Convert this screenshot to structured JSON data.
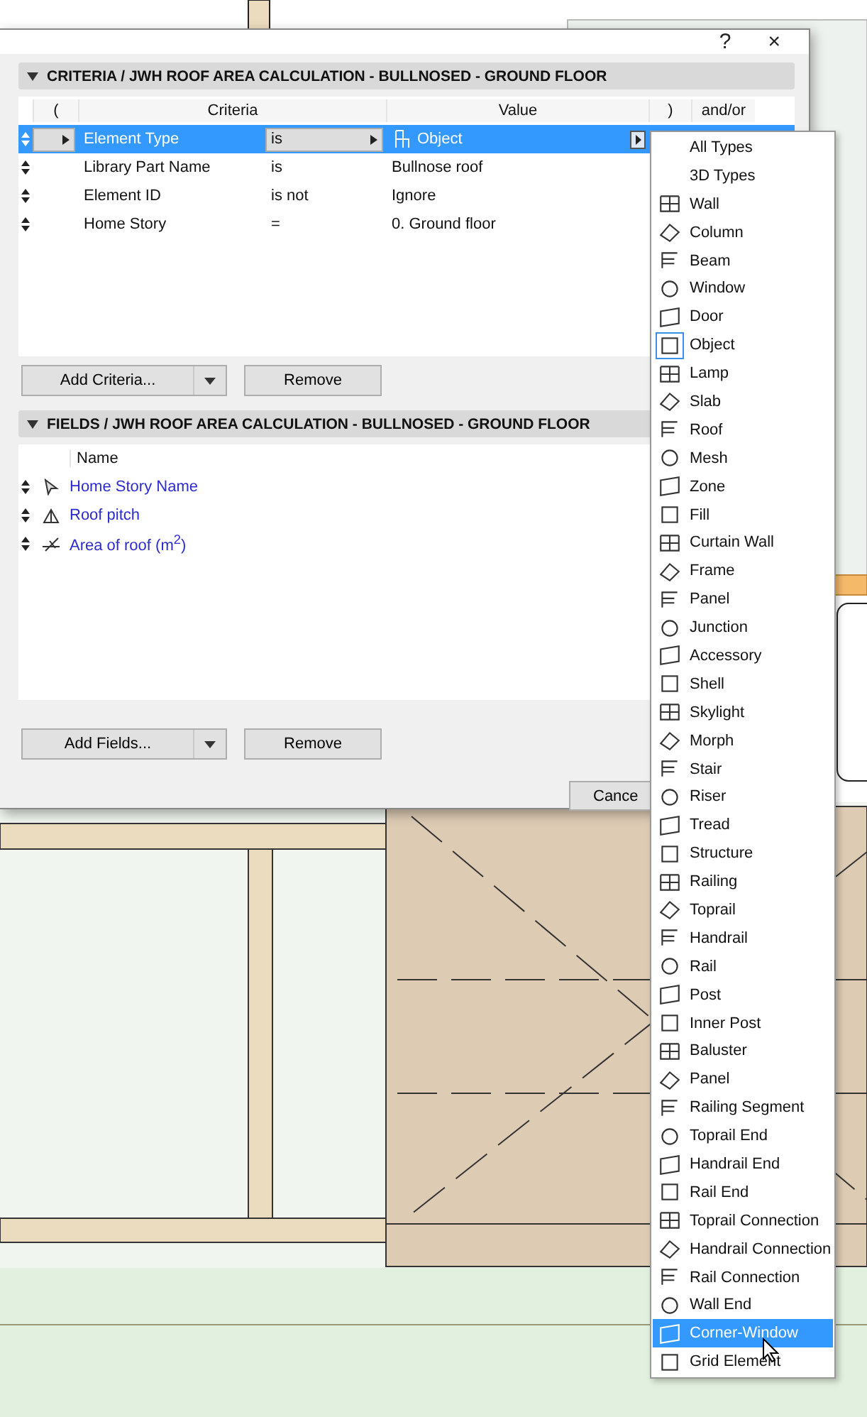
{
  "dialog": {
    "help": "?",
    "close": "×",
    "criteria": {
      "title": "CRITERIA / JWH ROOF AREA CALCULATION - BULLNOSED - GROUND FLOOR",
      "expanded": true,
      "columns": [
        "(",
        "Criteria",
        "Value",
        ")",
        "and/or"
      ],
      "rows": [
        {
          "criteria": "Element Type",
          "operator": "is",
          "value": "Object",
          "selected": true
        },
        {
          "criteria": "Library Part Name",
          "operator": "is",
          "value": "Bullnose roof",
          "selected": false
        },
        {
          "criteria": "Element ID",
          "operator": "is not",
          "value": "Ignore",
          "selected": false
        },
        {
          "criteria": "Home Story",
          "operator": "=",
          "value": "0. Ground floor",
          "selected": false
        }
      ],
      "buttons": [
        "Add Criteria...",
        "Remove"
      ]
    },
    "fields": {
      "title": "FIELDS / JWH ROOF AREA CALCULATION - BULLNOSED - GROUND FLOOR",
      "expanded": true,
      "column": "Name",
      "rows": [
        {
          "name": "Home Story Name",
          "kind": "pointer"
        },
        {
          "name": "Roof pitch",
          "kind": "angle"
        },
        {
          "name": "Area of roof (m$^{2}$)",
          "kind": "area"
        }
      ],
      "buttons": [
        "Add Fields...",
        "Remove"
      ]
    },
    "cancel": "Cance"
  },
  "menu": [
    {
      "label": "All Types",
      "selected": false,
      "current": false
    },
    {
      "label": "3D Types",
      "selected": false,
      "current": false
    },
    {
      "label": "Wall",
      "selected": false,
      "current": false
    },
    {
      "label": "Column",
      "selected": false,
      "current": false
    },
    {
      "label": "Beam",
      "selected": false,
      "current": false
    },
    {
      "label": "Window",
      "selected": false,
      "current": false
    },
    {
      "label": "Door",
      "selected": false,
      "current": false
    },
    {
      "label": "Object",
      "selected": false,
      "current": true
    },
    {
      "label": "Lamp",
      "selected": false,
      "current": false
    },
    {
      "label": "Slab",
      "selected": false,
      "current": false
    },
    {
      "label": "Roof",
      "selected": false,
      "current": false
    },
    {
      "label": "Mesh",
      "selected": false,
      "current": false
    },
    {
      "label": "Zone",
      "selected": false,
      "current": false
    },
    {
      "label": "Fill",
      "selected": false,
      "current": false
    },
    {
      "label": "Curtain Wall",
      "selected": false,
      "current": false
    },
    {
      "label": "Frame",
      "selected": false,
      "current": false
    },
    {
      "label": "Panel",
      "selected": false,
      "current": false
    },
    {
      "label": "Junction",
      "selected": false,
      "current": false
    },
    {
      "label": "Accessory",
      "selected": false,
      "current": false
    },
    {
      "label": "Shell",
      "selected": false,
      "current": false
    },
    {
      "label": "Skylight",
      "selected": false,
      "current": false
    },
    {
      "label": "Morph",
      "selected": false,
      "current": false
    },
    {
      "label": "Stair",
      "selected": false,
      "current": false
    },
    {
      "label": "Riser",
      "selected": false,
      "current": false
    },
    {
      "label": "Tread",
      "selected": false,
      "current": false
    },
    {
      "label": "Structure",
      "selected": false,
      "current": false
    },
    {
      "label": "Railing",
      "selected": false,
      "current": false
    },
    {
      "label": "Toprail",
      "selected": false,
      "current": false
    },
    {
      "label": "Handrail",
      "selected": false,
      "current": false
    },
    {
      "label": "Rail",
      "selected": false,
      "current": false
    },
    {
      "label": "Post",
      "selected": false,
      "current": false
    },
    {
      "label": "Inner Post",
      "selected": false,
      "current": false
    },
    {
      "label": "Baluster",
      "selected": false,
      "current": false
    },
    {
      "label": "Panel",
      "selected": false,
      "current": false
    },
    {
      "label": "Railing Segment",
      "selected": false,
      "current": false
    },
    {
      "label": "Toprail End",
      "selected": false,
      "current": false
    },
    {
      "label": "Handrail End",
      "selected": false,
      "current": false
    },
    {
      "label": "Rail End",
      "selected": false,
      "current": false
    },
    {
      "label": "Toprail Connection",
      "selected": false,
      "current": false
    },
    {
      "label": "Handrail Connection",
      "selected": false,
      "current": false
    },
    {
      "label": "Rail Connection",
      "selected": false,
      "current": false
    },
    {
      "label": "Wall End",
      "selected": false,
      "current": false
    },
    {
      "label": "Corner-Window",
      "selected": true,
      "current": false
    },
    {
      "label": "Grid Element",
      "selected": false,
      "current": false
    }
  ]
}
